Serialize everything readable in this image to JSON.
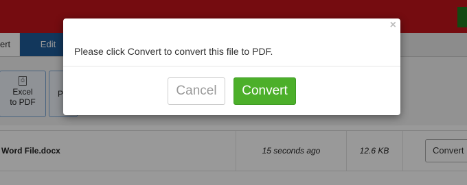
{
  "tabs": {
    "convert_partial": "ert",
    "edit": "Edit"
  },
  "tools": {
    "excel": {
      "line1": "Excel",
      "line2": "to PDF",
      "icon": "pdf-file-icon"
    },
    "ppt": {
      "partial": "P"
    }
  },
  "file": {
    "name": "Word File.docx",
    "time": "15 seconds ago",
    "size": "12.6 KB",
    "convert_label": "Convert"
  },
  "modal": {
    "close_glyph": "×",
    "message": "Please click Convert to convert this file to PDF.",
    "cancel_label": "Cancel",
    "convert_label": "Convert"
  },
  "colors": {
    "topbar": "#c3141b",
    "tab_active": "#1f5c99",
    "convert_button": "#4caf2a"
  }
}
